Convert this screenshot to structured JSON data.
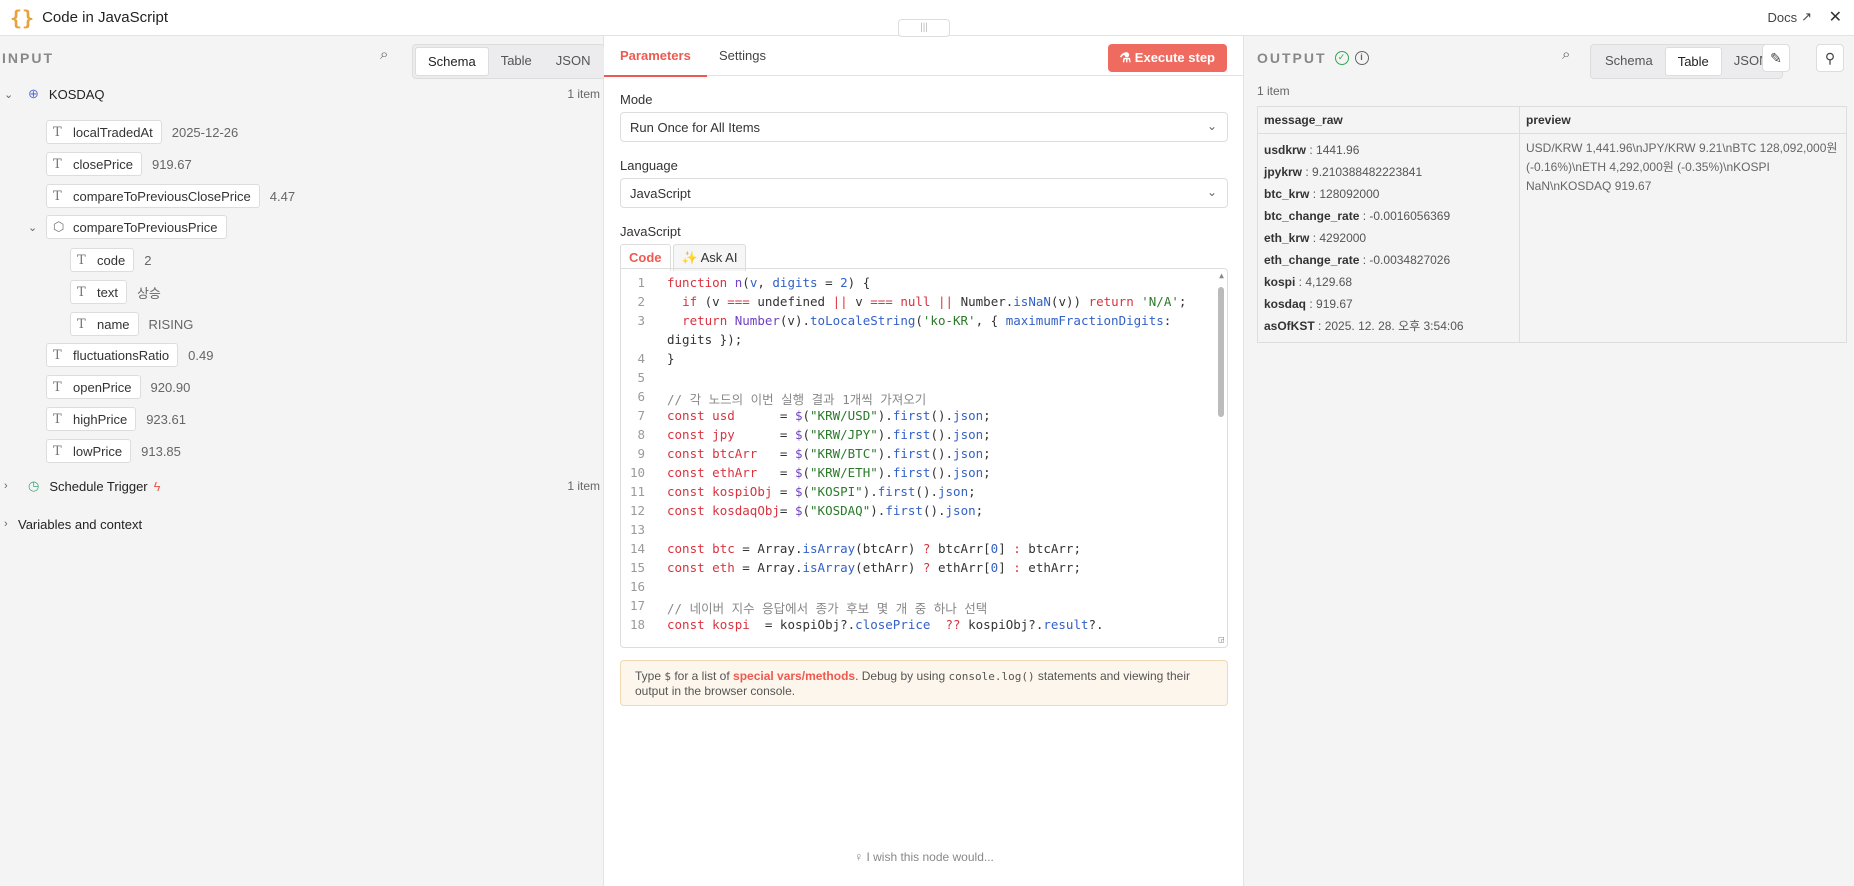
{
  "header": {
    "title": "Code in JavaScript",
    "docs": "Docs"
  },
  "input": {
    "label": "INPUT",
    "tabs": [
      "Schema",
      "Table",
      "JSON"
    ],
    "nodes": [
      {
        "name": "KOSDAQ",
        "count": "1 item"
      },
      {
        "name": "Schedule Trigger",
        "count": "1 item"
      }
    ],
    "fields": {
      "localTradedAt": {
        "key": "localTradedAt",
        "value": "2025-12-26"
      },
      "closePrice": {
        "key": "closePrice",
        "value": "919.67"
      },
      "compareToPreviousClosePrice": {
        "key": "compareToPreviousClosePrice",
        "value": "4.47"
      },
      "compareToPreviousPrice": {
        "key": "compareToPreviousPrice"
      },
      "code": {
        "key": "code",
        "value": "2"
      },
      "text": {
        "key": "text",
        "value": "상승"
      },
      "name": {
        "key": "name",
        "value": "RISING"
      },
      "fluctuationsRatio": {
        "key": "fluctuationsRatio",
        "value": "0.49"
      },
      "openPrice": {
        "key": "openPrice",
        "value": "920.90"
      },
      "highPrice": {
        "key": "highPrice",
        "value": "923.61"
      },
      "lowPrice": {
        "key": "lowPrice",
        "value": "913.85"
      }
    },
    "variables": "Variables and context"
  },
  "params": {
    "tabs": {
      "parameters": "Parameters",
      "settings": "Settings"
    },
    "execute": "Execute step",
    "mode_label": "Mode",
    "mode_value": "Run Once for All Items",
    "lang_label": "Language",
    "lang_value": "JavaScript",
    "code_label": "JavaScript",
    "code_tab": "Code",
    "ask_ai": "Ask AI",
    "hint": {
      "p1": "Type ",
      "dollar": "$",
      "p2": " for a list of ",
      "link": "special vars/methods",
      "p3": ". Debug by using ",
      "fn": "console.log()",
      "p4": " statements and viewing their output in the browser console."
    },
    "wish": "I wish this node would..."
  },
  "output": {
    "label": "OUTPUT",
    "count": "1 item",
    "tabs": [
      "Schema",
      "Table",
      "JSON"
    ],
    "columns": [
      "message_raw",
      "preview"
    ],
    "rows": [
      {
        "k": "usdkrw",
        "v": "1441.96"
      },
      {
        "k": "jpykrw",
        "v": "9.210388482223841"
      },
      {
        "k": "btc_krw",
        "v": "128092000"
      },
      {
        "k": "btc_change_rate",
        "v": "-0.0016056369"
      },
      {
        "k": "eth_krw",
        "v": "4292000"
      },
      {
        "k": "eth_change_rate",
        "v": "-0.0034827026"
      },
      {
        "k": "kospi",
        "v": "4,129.68"
      },
      {
        "k": "kosdaq",
        "v": "919.67"
      },
      {
        "k": "asOfKST",
        "v": "2025. 12. 28. 오후 3:54:06"
      }
    ],
    "preview": "USD/KRW 1,441.96\\nJPY/KRW 9.21\\nBTC 128,092,000원 (-0.16%)\\nETH 4,292,000원 (-0.35%)\\nKOSPI NaN\\nKOSDAQ 919.67"
  }
}
